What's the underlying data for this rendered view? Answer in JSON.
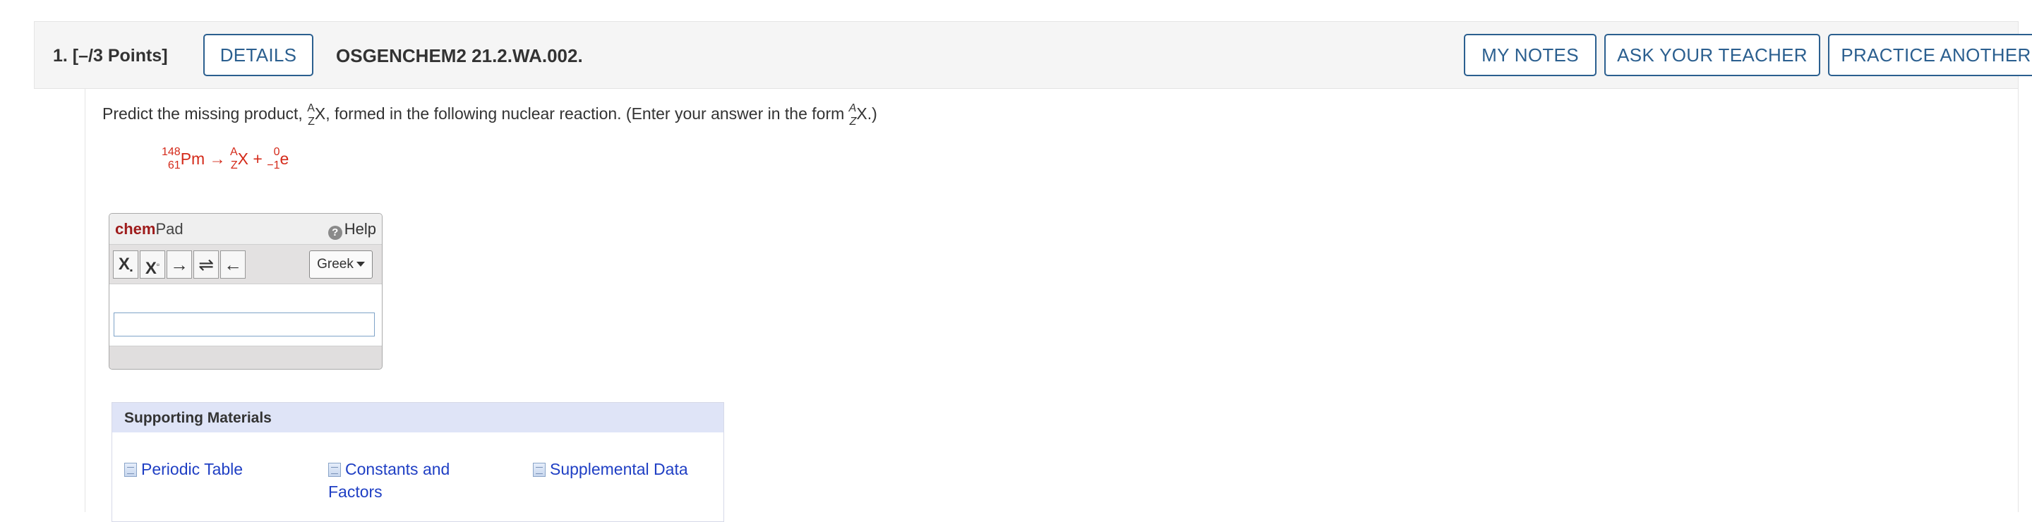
{
  "question": {
    "number_points": "1.  [–/3 Points]",
    "details_label": "DETAILS",
    "code": "OSGENCHEM2 21.2.WA.002.",
    "my_notes_label": "MY NOTES",
    "ask_teacher_label": "ASK YOUR TEACHER",
    "practice_label": "PRACTICE ANOTHER"
  },
  "prompt": {
    "before": "Predict the missing product, ",
    "sym_top": "A",
    "sym_bottom": "Z",
    "sym": "X",
    "middle": ", formed in the following nuclear reaction. (Enter your answer in the form ",
    "form_top": "A",
    "form_bottom": "Z",
    "form_sym": "X",
    "after": ".)"
  },
  "reaction": {
    "reactant_mass": "148",
    "reactant_atomic": "61",
    "reactant_symbol": "Pm",
    "arrow": "→",
    "product_mass": "A",
    "product_atomic": "Z",
    "product_symbol": "X",
    "plus": "+",
    "particle_mass": "0",
    "particle_atomic": "−1",
    "particle_symbol": "e"
  },
  "chempad": {
    "title_bold": "chem",
    "title_rest": "Pad",
    "help_label": "Help",
    "tools": [
      "X",
      "X",
      "→",
      "⇌",
      "←"
    ],
    "greek_label": "Greek",
    "input_value": ""
  },
  "supporting": {
    "title": "Supporting Materials",
    "links": [
      "Periodic Table",
      "Constants and Factors",
      "Supplemental Data"
    ]
  },
  "colors": {
    "button_border": "#2b5f8f",
    "reaction_red": "#d42a1a",
    "link_blue": "#1f3fc4",
    "support_header": "#dfe4f7"
  }
}
